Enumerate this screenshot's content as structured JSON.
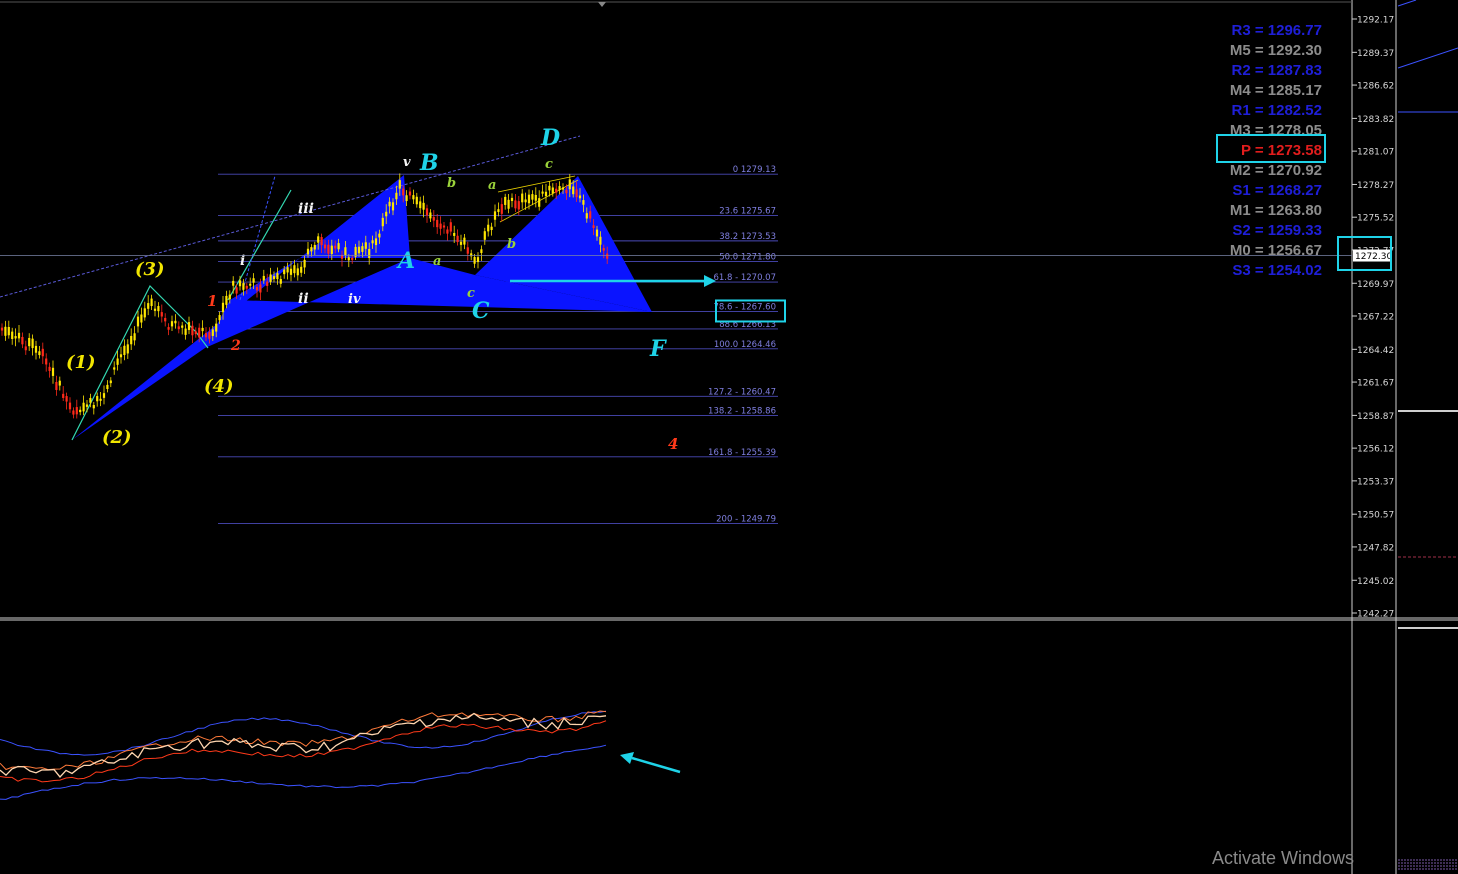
{
  "chart_data": {
    "type": "candlestick",
    "y_axis_ticks": [
      "1292.17",
      "1289.37",
      "1286.62",
      "1283.82",
      "1281.07",
      "1278.27",
      "1275.52",
      "1272.77",
      "1269.97",
      "1267.22",
      "1264.42",
      "1261.67",
      "1258.87",
      "1256.12",
      "1253.37",
      "1250.57",
      "1247.82",
      "1245.02",
      "1242.27"
    ],
    "ylim": [
      1242.27,
      1292.17
    ],
    "current_price": "1272.30",
    "fib_levels": [
      {
        "label": "0 1279.13",
        "value": 1279.13
      },
      {
        "label": "23.6 1275.67",
        "value": 1275.67
      },
      {
        "label": "38.2 1273.53",
        "value": 1273.53
      },
      {
        "label": "50.0 1271.80",
        "value": 1271.8
      },
      {
        "label": "61.8 - 1270.07",
        "value": 1270.07
      },
      {
        "label": "78.6 - 1267.60",
        "value": 1267.6
      },
      {
        "label": "88.6 1266.13",
        "value": 1266.13
      },
      {
        "label": "100.0 1264.46",
        "value": 1264.46
      },
      {
        "label": "127.2 - 1260.47",
        "value": 1260.47
      },
      {
        "label": "138.2 - 1258.86",
        "value": 1258.86
      },
      {
        "label": "161.8 - 1255.39",
        "value": 1255.39
      },
      {
        "label": "200 - 1249.79",
        "value": 1249.79
      }
    ],
    "pivots": [
      {
        "label": "R3 = 1296.77",
        "color": "#1f1fd8"
      },
      {
        "label": "M5 = 1292.30",
        "color": "#8c8c8c"
      },
      {
        "label": "R2 = 1287.83",
        "color": "#1f1fd8"
      },
      {
        "label": "M4 = 1285.17",
        "color": "#8c8c8c"
      },
      {
        "label": "R1 = 1282.52",
        "color": "#1f1fd8"
      },
      {
        "label": "M3 = 1278.05",
        "color": "#8c8c8c"
      },
      {
        "label": "P  = 1273.58",
        "color": "#e11d1d"
      },
      {
        "label": "M2 = 1270.92",
        "color": "#8c8c8c"
      },
      {
        "label": "S1 = 1268.27",
        "color": "#1f1fd8"
      },
      {
        "label": "M1 = 1263.80",
        "color": "#8c8c8c"
      },
      {
        "label": "S2 = 1259.33",
        "color": "#1f1fd8"
      },
      {
        "label": "M0 = 1256.67",
        "color": "#8c8c8c"
      },
      {
        "label": "S3 = 1254.02",
        "color": "#1f1fd8"
      }
    ],
    "wave_labels": [
      {
        "text": "(1)",
        "color": "#f2e600"
      },
      {
        "text": "(2)",
        "color": "#f2e600"
      },
      {
        "text": "(3)",
        "color": "#f2e600"
      },
      {
        "text": "(4)",
        "color": "#f2e600"
      },
      {
        "text": "1",
        "color": "#ff3a1a"
      },
      {
        "text": "2",
        "color": "#ff3a1a"
      },
      {
        "text": "4",
        "color": "#ff3a1a"
      },
      {
        "text": "i",
        "color": "#f5f5f5"
      },
      {
        "text": "ii",
        "color": "#f5f5f5"
      },
      {
        "text": "iii",
        "color": "#f5f5f5"
      },
      {
        "text": "iv",
        "color": "#f5f5f5"
      },
      {
        "text": "v",
        "color": "#f5f5f5"
      },
      {
        "text": "A",
        "color": "#1fd3e8"
      },
      {
        "text": "B",
        "color": "#1fd3e8"
      },
      {
        "text": "C",
        "color": "#1fd3e8"
      },
      {
        "text": "D",
        "color": "#1fd3e8"
      },
      {
        "text": "F",
        "color": "#1fd3e8"
      },
      {
        "text": "a",
        "color": "#9ad23a"
      },
      {
        "text": "b",
        "color": "#9ad23a"
      },
      {
        "text": "a",
        "color": "#9ad23a"
      },
      {
        "text": "b",
        "color": "#9ad23a"
      },
      {
        "text": "c",
        "color": "#9ad23a"
      },
      {
        "text": "c",
        "color": "#9ad23a"
      }
    ],
    "colors": {
      "background": "#000000",
      "pattern_fill": "#0a14ff",
      "cyan": "#1fd3e8",
      "fib_line": "#4a4ab8",
      "fib_text": "#7f7fe0",
      "bull_candle": "#ffe600",
      "bear_candle": "#ff2a1a"
    }
  },
  "watermark": "Activate Windows"
}
